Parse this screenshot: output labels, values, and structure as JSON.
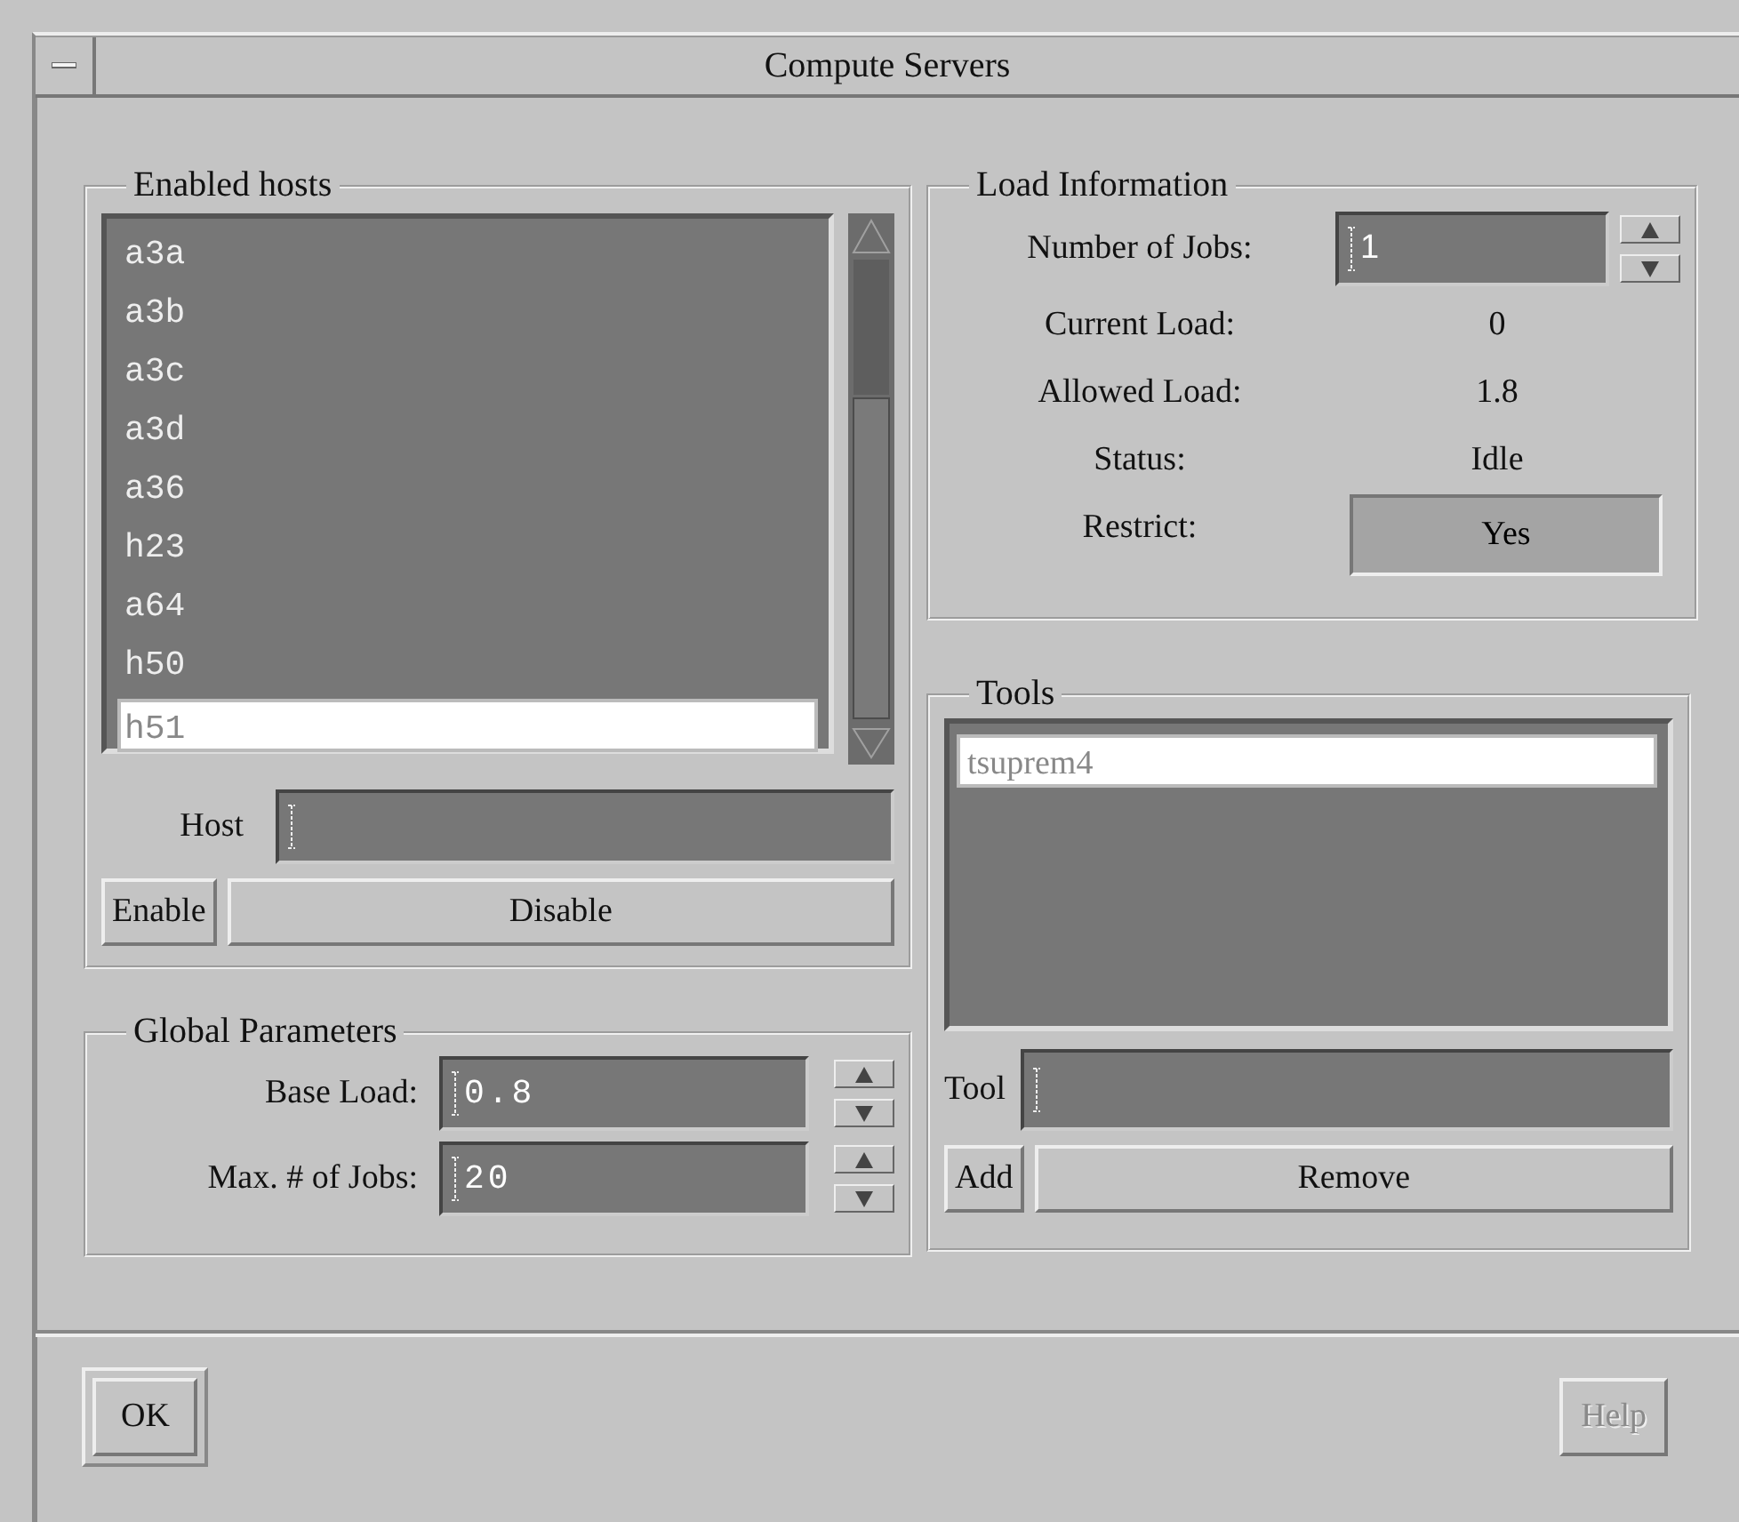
{
  "window": {
    "title": "Compute Servers"
  },
  "enabled_hosts": {
    "title": "Enabled hosts",
    "hosts": [
      {
        "name": "a3a",
        "selected": false
      },
      {
        "name": "a3b",
        "selected": false
      },
      {
        "name": "a3c",
        "selected": false
      },
      {
        "name": "a3d",
        "selected": false
      },
      {
        "name": "a36",
        "selected": false
      },
      {
        "name": "h23",
        "selected": false
      },
      {
        "name": "a64",
        "selected": false
      },
      {
        "name": "h50",
        "selected": false
      },
      {
        "name": "h51",
        "selected": true
      }
    ],
    "host_label": "Host",
    "buttons": [
      {
        "label": "Enable"
      },
      {
        "label": "Disable"
      }
    ]
  },
  "global_parameters": {
    "title": "Global Parameters",
    "fields": [
      {
        "label": "Base Load:",
        "value": "0.8"
      },
      {
        "label": "Max. # of Jobs:",
        "value": "20"
      }
    ]
  },
  "load_information": {
    "title": "Load Information",
    "rows": [
      {
        "kind": "spin",
        "label": "Number of Jobs:",
        "value": "1"
      },
      {
        "kind": "value",
        "label": "Current Load:",
        "value": "0"
      },
      {
        "kind": "value",
        "label": "Allowed Load:",
        "value": "1.8"
      },
      {
        "kind": "value",
        "label": "Status:",
        "value": "Idle"
      },
      {
        "kind": "toggle",
        "label": "Restrict:",
        "value": "Yes",
        "on": true
      }
    ]
  },
  "tools": {
    "title": "Tools",
    "items": [
      {
        "name": "tsuprem4",
        "selected": true
      }
    ],
    "tool_label": "Tool",
    "buttons": [
      {
        "label": "Add"
      },
      {
        "label": "Remove"
      }
    ]
  },
  "buttons": [
    {
      "label": "OK",
      "default": true,
      "disabled": false
    },
    {
      "label": "Help",
      "default": false,
      "disabled": true
    }
  ]
}
